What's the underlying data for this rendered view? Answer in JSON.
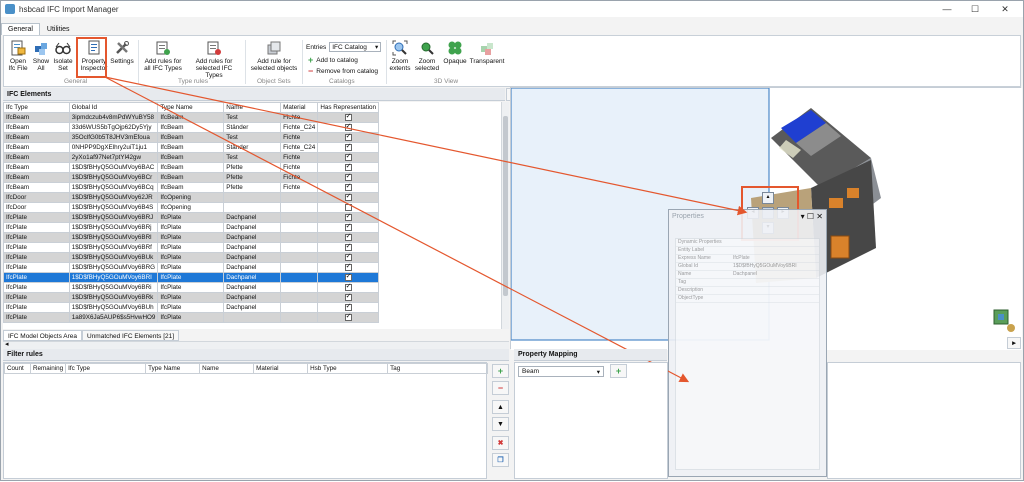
{
  "window": {
    "title": "hsbcad IFC Import Manager",
    "minimize": "—",
    "maximize": "☐",
    "close": "✕"
  },
  "tabs": [
    {
      "label": "General"
    },
    {
      "label": "Utilities"
    }
  ],
  "ribbon": {
    "general": {
      "open": "Open Ifc File",
      "show_all": "Show All",
      "isolate": "Isolate Set",
      "property_inspector": "Property Inspector",
      "settings": "Settings",
      "group": "General"
    },
    "type_rules": {
      "add_all": "Add rules for all IFC Types",
      "add_selected": "Add rules for selected IFC Types",
      "group": "Type rules"
    },
    "object_sets": {
      "add_selected_objects": "Add rule for selected objects",
      "group": "Object Sets"
    },
    "catalogs": {
      "entries_label": "Entries",
      "entries_value": "IFC Catalog",
      "add": "Add to catalog",
      "remove": "Remove from catalog",
      "group": "Catalogs"
    },
    "view3d": {
      "zoom_extents": "Zoom extents",
      "zoom_selected": "Zoom selected",
      "opaque": "Opaque",
      "transparent": "Transparent",
      "group": "3D View"
    }
  },
  "ifc_elements": {
    "title": "IFC Elements",
    "columns": [
      "Ifc Type",
      "Global Id",
      "Type Name",
      "Name",
      "Material",
      "Has Representation"
    ],
    "rows": [
      {
        "type": "IfcBeam",
        "gid": "3ipmdczub4v8mPdWYuBY58",
        "tname": "IfcBeam",
        "name": "Test",
        "mat": "Fichte",
        "rep": true
      },
      {
        "type": "IfcBeam",
        "gid": "33d6WUS5bTgOjp62Dy5Yjy",
        "tname": "IfcBeam",
        "name": "Ständer",
        "mat": "Fichte_C24",
        "rep": true
      },
      {
        "type": "IfcBeam",
        "gid": "35OclfG0b5T8JHV3mEfoua",
        "tname": "IfcBeam",
        "name": "Test",
        "mat": "Fichte",
        "rep": true
      },
      {
        "type": "IfcBeam",
        "gid": "0NHPP9DgXElhry2uiT1ju1",
        "tname": "IfcBeam",
        "name": "Ständer",
        "mat": "Fichte_C24",
        "rep": true
      },
      {
        "type": "IfcBeam",
        "gid": "2yXo1af97Net7ptYl42gw",
        "tname": "IfcBeam",
        "name": "Test",
        "mat": "Fichte",
        "rep": true
      },
      {
        "type": "IfcBeam",
        "gid": "1$D$fBHyQ5GOuMVoy6BAC",
        "tname": "IfcBeam",
        "name": "Pfette",
        "mat": "Fichte",
        "rep": true
      },
      {
        "type": "IfcBeam",
        "gid": "1$D$fBHyQ5GOuMVoy6BCr",
        "tname": "IfcBeam",
        "name": "Pfette",
        "mat": "Fichte",
        "rep": true
      },
      {
        "type": "IfcBeam",
        "gid": "1$D$fBHyQ5GOuMVoy6BCq",
        "tname": "IfcBeam",
        "name": "Pfette",
        "mat": "Fichte",
        "rep": true
      },
      {
        "type": "IfcDoor",
        "gid": "1$D$fBHyQ5GOuMVoy62JR",
        "tname": "IfcOpening",
        "name": "",
        "mat": "",
        "rep": true
      },
      {
        "type": "IfcDoor",
        "gid": "1$D$fBHyQ5GOuMVoy6B4S",
        "tname": "IfcOpening",
        "name": "",
        "mat": "",
        "rep": false
      },
      {
        "type": "IfcPlate",
        "gid": "1$D$fBHyQ5GOuMVoy6BRJ",
        "tname": "IfcPlate",
        "name": "Dachpanel",
        "mat": "",
        "rep": true
      },
      {
        "type": "IfcPlate",
        "gid": "1$D$fBHyQ5GOuMVoy6BRj",
        "tname": "IfcPlate",
        "name": "Dachpanel",
        "mat": "",
        "rep": true
      },
      {
        "type": "IfcPlate",
        "gid": "1$D$fBHyQ5GOuMVoy6BRl",
        "tname": "IfcPlate",
        "name": "Dachpanel",
        "mat": "",
        "rep": true
      },
      {
        "type": "IfcPlate",
        "gid": "1$D$fBHyQ5GOuMVoy6BRf",
        "tname": "IfcPlate",
        "name": "Dachpanel",
        "mat": "",
        "rep": true
      },
      {
        "type": "IfcPlate",
        "gid": "1$D$fBHyQ5GOuMVoy6BUk",
        "tname": "IfcPlate",
        "name": "Dachpanel",
        "mat": "",
        "rep": true
      },
      {
        "type": "IfcPlate",
        "gid": "1$D$fBHyQ5GOuMVoy6BRG",
        "tname": "IfcPlate",
        "name": "Dachpanel",
        "mat": "",
        "rep": true
      },
      {
        "type": "IfcPlate",
        "gid": "1$D$fBHyQ5GOuMVoy6BRI",
        "tname": "IfcPlate",
        "name": "Dachpanel",
        "mat": "",
        "rep": true,
        "selected": true
      },
      {
        "type": "IfcPlate",
        "gid": "1$D$fBHyQ5GOuMVoy6BRi",
        "tname": "IfcPlate",
        "name": "Dachpanel",
        "mat": "",
        "rep": true
      },
      {
        "type": "IfcPlate",
        "gid": "1$D$fBHyQ5GOuMVoy6BRk",
        "tname": "IfcPlate",
        "name": "Dachpanel",
        "mat": "",
        "rep": true
      },
      {
        "type": "IfcPlate",
        "gid": "1$D$fBHyQ5GOuMVoy6BUh",
        "tname": "IfcPlate",
        "name": "Dachpanel",
        "mat": "",
        "rep": true
      },
      {
        "type": "IfcPlate",
        "gid": "1a89X6Ja5AUP6$s5HvwHO9",
        "tname": "IfcPlate",
        "name": "",
        "mat": "",
        "rep": true
      }
    ],
    "bottom_tabs": [
      "IFC Model Objects Area",
      "Unmatched IFC Elements [21]"
    ]
  },
  "filter_rules": {
    "title": "Filter rules",
    "columns": [
      "Count",
      "Remaining",
      "Ifc Type",
      "Type Name",
      "Name",
      "Material",
      "Hsb Type",
      "Tag"
    ]
  },
  "property_mapping": {
    "title": "Property Mapping",
    "select_value": "Beam"
  },
  "properties_window": {
    "title": "Properties",
    "rows": [
      {
        "k": "Dynamic Properties",
        "v": ""
      },
      {
        "k": "Entity Label",
        "v": ""
      },
      {
        "k": "Express Name",
        "v": "IfcPlate"
      },
      {
        "k": "Global Id",
        "v": "1$D$fBHyQ5GOuMVoy6BRI"
      },
      {
        "k": "Name",
        "v": "Dachpanel"
      },
      {
        "k": "Tag",
        "v": ""
      },
      {
        "k": "Description",
        "v": ""
      },
      {
        "k": "ObjectType",
        "v": ""
      }
    ]
  },
  "colors": {
    "accent": "#e4572e",
    "selection": "#1e78d7",
    "green": "#3fa34d",
    "red": "#d23b3b"
  }
}
